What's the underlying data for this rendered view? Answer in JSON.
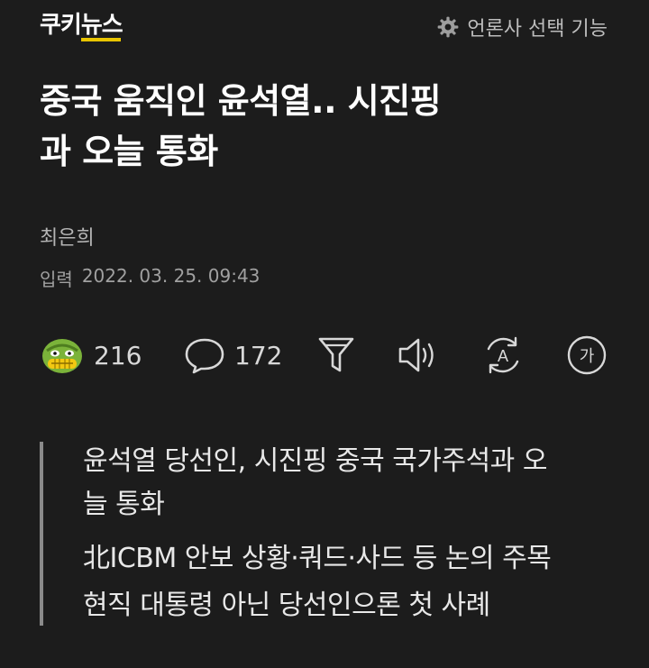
{
  "header": {
    "logo_main": "쿠키",
    "logo_accent": "뉴스",
    "press_select_label": "언론사 선택 기능"
  },
  "article": {
    "title_line1": "중국 움직인 윤석열.. 시진핑",
    "title_line2": "과 오늘 통화",
    "author": "최은희",
    "date_label": "입력",
    "date_value": "2022. 03. 25. 09:43"
  },
  "actions": {
    "reaction_count": "216",
    "comment_count": "172",
    "summary_icon": "funnel-icon",
    "listen_icon": "speaker-icon",
    "translate_letter": "A",
    "font_size_letter": "가"
  },
  "summary": {
    "lines": [
      "윤석열 당선인, 시진핑 중국 국가주석과 오",
      "늘 통화",
      "北ICBM 안보 상황·쿼드·사드 등 논의 주목",
      "현직 대통령 아닌 당선인으론 첫 사례"
    ]
  },
  "colors": {
    "background": "#1c1c1c",
    "logo_accent": "#e8c400",
    "reaction_face": "#7bb33a"
  }
}
